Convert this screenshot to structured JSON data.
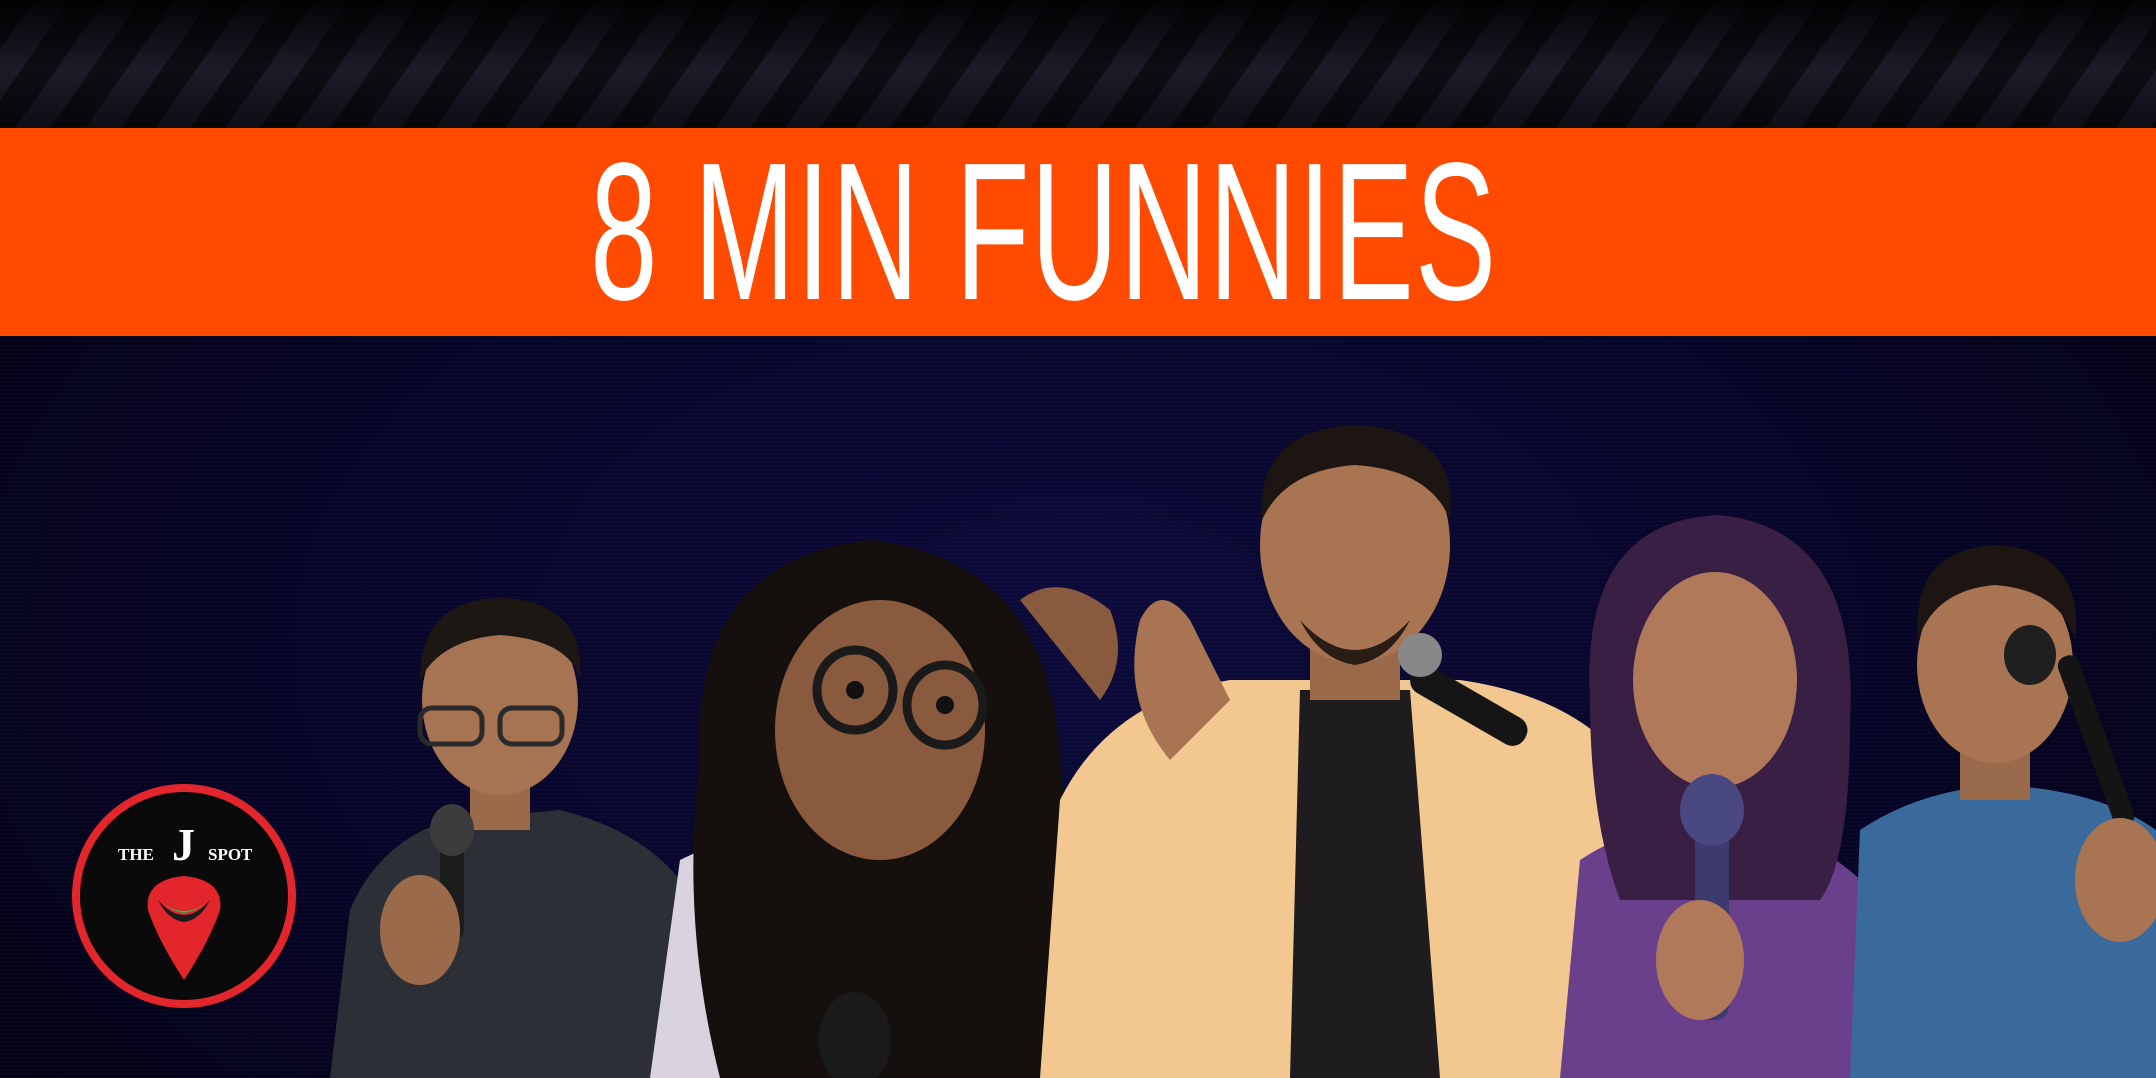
{
  "banner": {
    "title": "8 MIN FUNNIES"
  },
  "logo": {
    "the": "THE",
    "j": "J",
    "spot": "SPOT"
  },
  "colors": {
    "banner_orange": "#ff4a00",
    "background_navy": "#070526",
    "logo_red": "#e3262b"
  }
}
